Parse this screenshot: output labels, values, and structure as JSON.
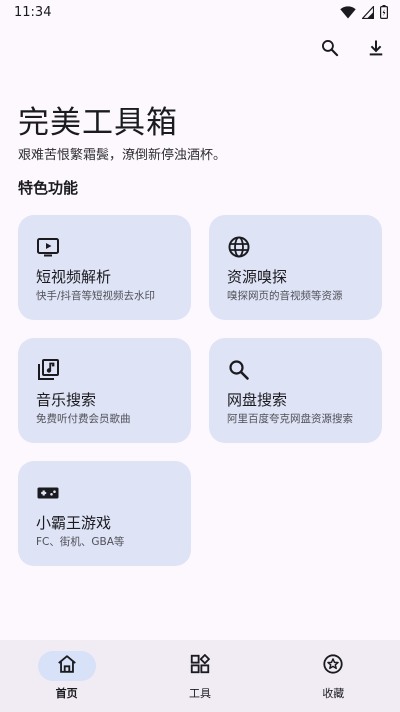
{
  "status_bar": {
    "time": "11:34",
    "icons": [
      "wifi-icon",
      "signal-icon",
      "battery-icon"
    ]
  },
  "app_bar": {
    "actions": [
      "search-icon",
      "download-icon"
    ]
  },
  "header": {
    "title": "完美工具箱",
    "subtitle": "艰难苦恨繁霜鬓，潦倒新停浊酒杯。"
  },
  "section": {
    "title": "特色功能"
  },
  "cards": [
    {
      "icon": "video-icon",
      "title": "短视频解析",
      "desc": "快手/抖音等短视频去水印"
    },
    {
      "icon": "globe-icon",
      "title": "资源嗅探",
      "desc": "嗅探网页的音视频等资源"
    },
    {
      "icon": "music-library-icon",
      "title": "音乐搜索",
      "desc": "免费听付费会员歌曲"
    },
    {
      "icon": "search-icon",
      "title": "网盘搜索",
      "desc": "阿里百度夸克网盘资源搜索"
    },
    {
      "icon": "gamepad-icon",
      "title": "小霸王游戏",
      "desc": "FC、街机、GBA等"
    }
  ],
  "bottom_nav": {
    "items": [
      {
        "icon": "home-icon",
        "label": "首页",
        "active": true
      },
      {
        "icon": "widgets-icon",
        "label": "工具",
        "active": false
      },
      {
        "icon": "star-circle-icon",
        "label": "收藏",
        "active": false
      }
    ]
  },
  "colors": {
    "background": "#fdf8fd",
    "card": "#dee3f6",
    "nav_background": "#f1ecf4",
    "nav_active_pill": "#d7e1f7",
    "text_primary": "#1b1b1f",
    "text_secondary": "#505058"
  }
}
